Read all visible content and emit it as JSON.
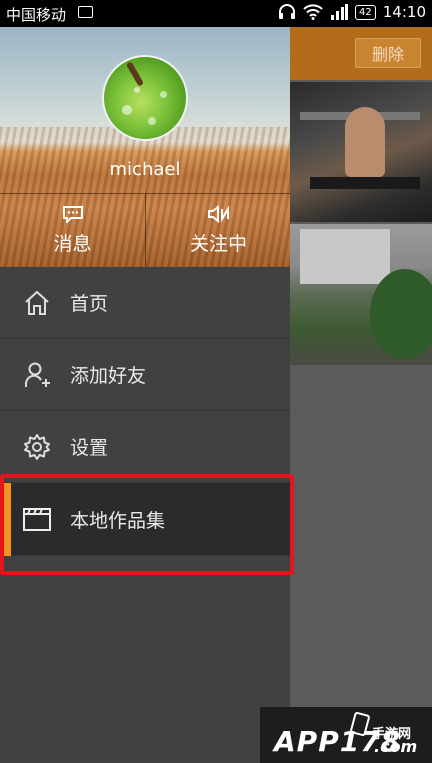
{
  "status_bar": {
    "carrier": "中国移动",
    "battery": "42",
    "time": "14:10"
  },
  "background": {
    "delete_label": "删除"
  },
  "drawer": {
    "username": "michael",
    "header_buttons": [
      {
        "label": "消息",
        "icon": "message-icon"
      },
      {
        "label": "关注中",
        "icon": "following-icon"
      }
    ],
    "menu": [
      {
        "label": "首页",
        "icon": "home-icon"
      },
      {
        "label": "添加好友",
        "icon": "add-friend-icon"
      },
      {
        "label": "设置",
        "icon": "gear-icon"
      },
      {
        "label": "本地作品集",
        "icon": "folder-icon",
        "active": true
      }
    ],
    "accent_color": "#f7931e",
    "highlight_color": "#e8141b"
  },
  "watermark": {
    "brand": "APP178",
    "sub": "手游网",
    "domain": ".com"
  }
}
